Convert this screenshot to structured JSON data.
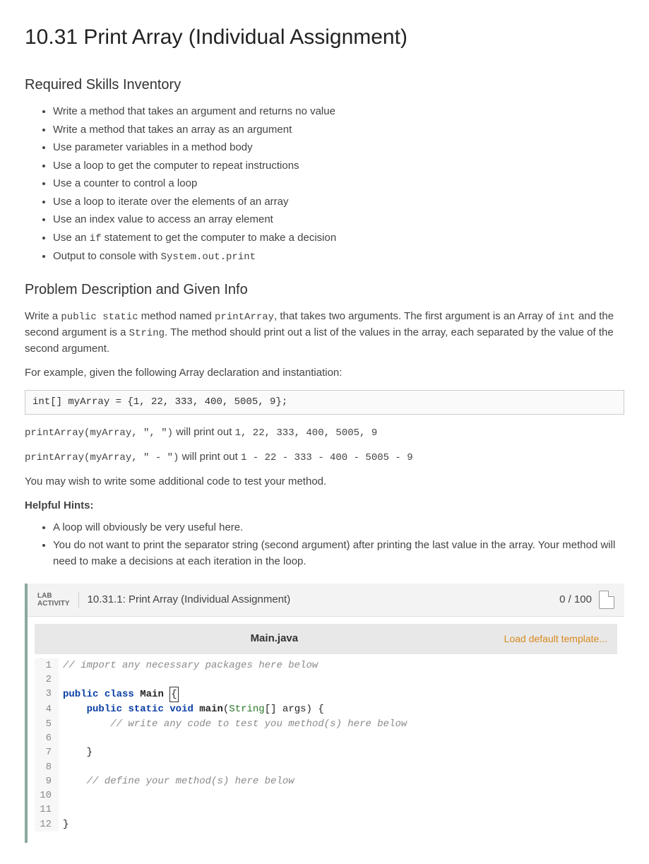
{
  "title": "10.31 Print Array (Individual Assignment)",
  "skills_heading": "Required Skills Inventory",
  "skills": [
    "Write a method that takes an argument and returns no value",
    "Write a method that takes an array as an argument",
    "Use parameter variables in a method body",
    "Use a loop to get the computer to repeat instructions",
    "Use a counter to control a loop",
    "Use a loop to iterate over the elements of an array",
    "Use an index value to access an array element",
    {
      "pre": "Use an ",
      "code": "if",
      "post": " statement to get the computer to make a decision"
    },
    {
      "pre": "Output to console with ",
      "code": "System.out.print",
      "post": ""
    }
  ],
  "problem_heading": "Problem Description and Given Info",
  "desc1_pre": "Write a ",
  "desc1_code1": "public static",
  "desc1_mid1": " method named ",
  "desc1_code2": "printArray",
  "desc1_mid2": ", that takes two arguments. The first argument is an Array of ",
  "desc1_code3": "int",
  "desc1_mid3": " and the second argument is a ",
  "desc1_code4": "String",
  "desc1_post": ". The method should print out a list of the values in the array, each separated by the value of the second argument.",
  "desc2": "For example, given the following Array declaration and instantiation:",
  "decl_code": "int[] myArray = {1, 22, 333, 400, 5005, 9};",
  "ex1_call": "printArray(myArray, \", \")",
  "ex1_mid": " will print out ",
  "ex1_out": "1, 22, 333, 400, 5005, 9",
  "ex2_call": "printArray(myArray, \" - \")",
  "ex2_mid": " will print out ",
  "ex2_out": "1 - 22 - 333 - 400 - 5005 - 9",
  "desc3": "You may wish to write some additional code to test your method.",
  "hints_heading": "Helpful Hints:",
  "hints": [
    "A loop will obviously be very useful here.",
    "You do not want to print the separator string (second argument) after printing the last value in the array. Your method will need to make a decisions at each iteration in the loop."
  ],
  "lab": {
    "label_top": "LAB",
    "label_bottom": "ACTIVITY",
    "title": "10.31.1: Print Array (Individual Assignment)",
    "score": "0 / 100",
    "filename": "Main.java",
    "load_template": "Load default template...",
    "lines": [
      [
        {
          "cls": "tok-comment",
          "t": "// import any necessary packages here below"
        }
      ],
      [
        {
          "cls": "tok-plain",
          "t": ""
        }
      ],
      [
        {
          "cls": "tok-keyword",
          "t": "public"
        },
        {
          "cls": "tok-plain",
          "t": " "
        },
        {
          "cls": "tok-keyword",
          "t": "class"
        },
        {
          "cls": "tok-plain",
          "t": " "
        },
        {
          "cls": "tok-ident",
          "t": "Main"
        },
        {
          "cls": "tok-plain",
          "t": " "
        },
        {
          "cls": "cursor-box tok-plain",
          "t": "{"
        }
      ],
      [
        {
          "cls": "tok-plain",
          "t": "    "
        },
        {
          "cls": "tok-keyword",
          "t": "public"
        },
        {
          "cls": "tok-plain",
          "t": " "
        },
        {
          "cls": "tok-keyword",
          "t": "static"
        },
        {
          "cls": "tok-plain",
          "t": " "
        },
        {
          "cls": "tok-keyword",
          "t": "void"
        },
        {
          "cls": "tok-plain",
          "t": " "
        },
        {
          "cls": "tok-ident",
          "t": "main"
        },
        {
          "cls": "tok-plain",
          "t": "("
        },
        {
          "cls": "tok-type",
          "t": "String"
        },
        {
          "cls": "tok-plain",
          "t": "[] args) {"
        }
      ],
      [
        {
          "cls": "tok-plain",
          "t": "        "
        },
        {
          "cls": "tok-comment",
          "t": "// write any code to test you method(s) here below"
        }
      ],
      [
        {
          "cls": "tok-plain",
          "t": ""
        }
      ],
      [
        {
          "cls": "tok-plain",
          "t": "    }"
        }
      ],
      [
        {
          "cls": "tok-plain",
          "t": ""
        }
      ],
      [
        {
          "cls": "tok-plain",
          "t": "    "
        },
        {
          "cls": "tok-comment",
          "t": "// define your method(s) here below"
        }
      ],
      [
        {
          "cls": "tok-plain",
          "t": ""
        }
      ],
      [
        {
          "cls": "tok-plain",
          "t": ""
        }
      ],
      [
        {
          "cls": "tok-plain",
          "t": "}"
        }
      ]
    ]
  }
}
